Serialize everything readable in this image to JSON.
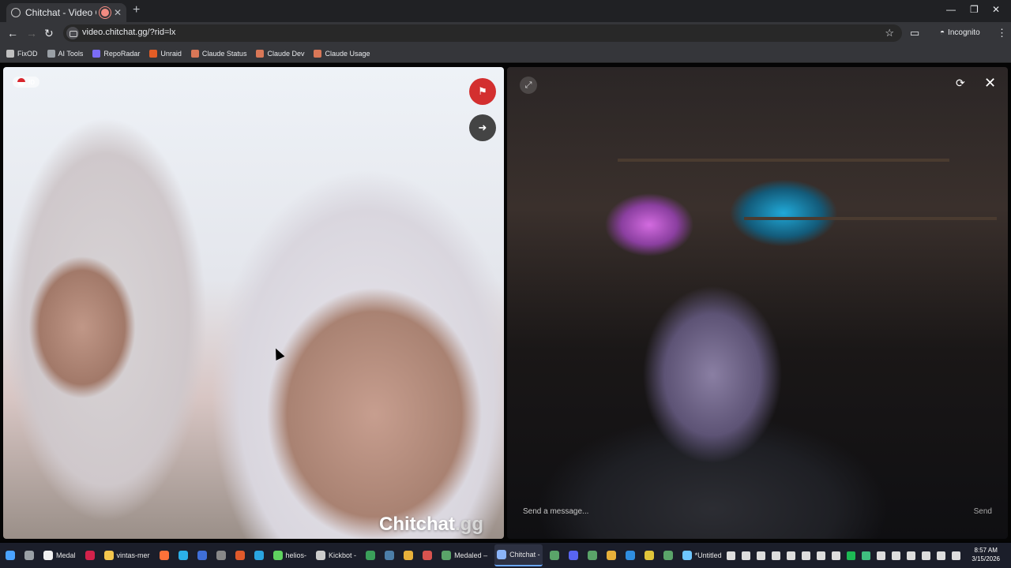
{
  "browser": {
    "tab_title": "Chitchat - Video Chat",
    "new_tab": "+",
    "url": "video.chitchat.gg/?rid=lx",
    "incognito_label": "Incognito",
    "window_controls": [
      "—",
      "❐",
      "✕"
    ]
  },
  "bookmarks": [
    {
      "label": "FixOD",
      "icon": "fixod-icon",
      "color": "#c0c0c0"
    },
    {
      "label": "AI Tools",
      "icon": "folder-icon",
      "color": "#9aa0a6"
    },
    {
      "label": "RepoRadar",
      "icon": "reporadar-icon",
      "color": "#7b6cf6"
    },
    {
      "label": "Unraid",
      "icon": "unraid-icon",
      "color": "#e35d26"
    },
    {
      "label": "Claude Status",
      "icon": "claude-icon",
      "color": "#d97757"
    },
    {
      "label": "Claude Dev",
      "icon": "claude-icon",
      "color": "#d97757"
    },
    {
      "label": "Claude Usage",
      "icon": "claude-icon",
      "color": "#d97757"
    }
  ],
  "left_video": {
    "country_code": "ID",
    "brand_main": "Chitchat",
    "brand_suffix": ".gg"
  },
  "right_video": {
    "message_placeholder": "Send a message...",
    "send_label": "Send"
  },
  "taskbar": {
    "items": [
      {
        "label": "",
        "icon": "windows-start-icon",
        "color": "#4aa3ff",
        "active": false
      },
      {
        "label": "",
        "icon": "search-icon",
        "color": "#9aa0a6",
        "active": false
      },
      {
        "label": "Medal",
        "icon": "medal-icon",
        "color": "#f0f0f0",
        "active": false
      },
      {
        "label": "",
        "icon": "affinity-icon",
        "color": "#d3224b",
        "active": false
      },
      {
        "label": "vintas-mer",
        "icon": "folder-icon",
        "color": "#f3c64d",
        "active": false
      },
      {
        "label": "",
        "icon": "firefox-icon",
        "color": "#ff7139",
        "active": false
      },
      {
        "label": "",
        "icon": "edge-icon",
        "color": "#2bb0e8",
        "active": false
      },
      {
        "label": "",
        "icon": "app-icon",
        "color": "#3f6fd8",
        "active": false
      },
      {
        "label": "",
        "icon": "app-icon",
        "color": "#888",
        "active": false
      },
      {
        "label": "",
        "icon": "app-icon",
        "color": "#e05a2b",
        "active": false
      },
      {
        "label": "",
        "icon": "telegram-icon",
        "color": "#2aa5e0",
        "active": false
      },
      {
        "label": "helios-",
        "icon": "terminal-icon",
        "color": "#5fd35f",
        "active": false
      },
      {
        "label": "Kickbot -",
        "icon": "terminal-icon",
        "color": "#cccccc",
        "active": false
      },
      {
        "label": "",
        "icon": "app-icon",
        "color": "#3aa05a",
        "active": false
      },
      {
        "label": "",
        "icon": "steam-icon",
        "color": "#4c7ea8",
        "active": false
      },
      {
        "label": "",
        "icon": "chrome-icon",
        "color": "#e8b13a",
        "active": false
      },
      {
        "label": "",
        "icon": "chrome-icon",
        "color": "#d9534f",
        "active": false
      },
      {
        "label": "Medaled –",
        "icon": "chrome-icon",
        "color": "#5aa469",
        "active": false
      },
      {
        "label": "Chitchat -",
        "icon": "chrome-icon",
        "color": "#8ab4f8",
        "active": true
      },
      {
        "label": "",
        "icon": "chrome-icon",
        "color": "#5aa469",
        "active": false
      },
      {
        "label": "",
        "icon": "discord-icon",
        "color": "#5865f2",
        "active": false
      },
      {
        "label": "",
        "icon": "chrome-icon",
        "color": "#5aa469",
        "active": false
      },
      {
        "label": "",
        "icon": "chrome-icon",
        "color": "#e8b13a",
        "active": false
      },
      {
        "label": "",
        "icon": "vscode-icon",
        "color": "#2f8ee0",
        "active": false
      },
      {
        "label": "",
        "icon": "app-icon",
        "color": "#e0c53a",
        "active": false
      },
      {
        "label": "",
        "icon": "chrome-icon",
        "color": "#5aa469",
        "active": false
      },
      {
        "label": "*Untitled",
        "icon": "notepad-icon",
        "color": "#6ec6ff",
        "active": false
      }
    ],
    "tray": [
      {
        "icon": "brightness-icon",
        "color": "#dddddd"
      },
      {
        "icon": "app-icon",
        "color": "#dddddd"
      },
      {
        "icon": "app-icon",
        "color": "#dddddd"
      },
      {
        "icon": "app-icon",
        "color": "#dddddd"
      },
      {
        "icon": "discord-icon",
        "color": "#dddddd"
      },
      {
        "icon": "steam-icon",
        "color": "#dddddd"
      },
      {
        "icon": "app-icon",
        "color": "#dddddd"
      },
      {
        "icon": "app-icon",
        "color": "#dddddd"
      },
      {
        "icon": "spotify-icon",
        "color": "#1db954"
      },
      {
        "icon": "app-icon",
        "color": "#3fbf7f"
      },
      {
        "icon": "app-icon",
        "color": "#dddddd"
      },
      {
        "icon": "app-icon",
        "color": "#dddddd"
      },
      {
        "icon": "microphone-icon",
        "color": "#dddddd"
      },
      {
        "icon": "network-icon",
        "color": "#dddddd"
      },
      {
        "icon": "volume-icon",
        "color": "#dddddd"
      },
      {
        "icon": "battery-icon",
        "color": "#dddddd"
      }
    ],
    "time": "8:57 AM",
    "date": "3/15/2026"
  }
}
